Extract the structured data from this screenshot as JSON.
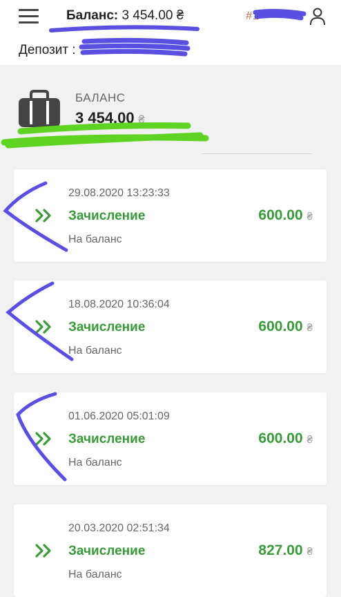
{
  "header": {
    "balance_label": "Баланс:",
    "balance_value": "3 454.00",
    "currency": "₴",
    "account_id": "#1",
    "deposit_label": "Депозит :"
  },
  "summary": {
    "label": "БАЛАНС",
    "amount": "3 454.00",
    "currency": "₴"
  },
  "transactions": [
    {
      "date": "29.08.2020 13:23:33",
      "type": "Зачисление",
      "amount": "600.00",
      "currency": "₴",
      "description": "На баланс"
    },
    {
      "date": "18.08.2020 10:36:04",
      "type": "Зачисление",
      "amount": "600.00",
      "currency": "₴",
      "description": "На баланс"
    },
    {
      "date": "01.06.2020 05:01:09",
      "type": "Зачисление",
      "amount": "600.00",
      "currency": "₴",
      "description": "На баланс"
    },
    {
      "date": "20.03.2020 02:51:34",
      "type": "Зачисление",
      "amount": "827.00",
      "currency": "₴",
      "description": "На баланс"
    }
  ],
  "icons": {
    "menu": "hamburger-menu-icon",
    "user": "user-icon",
    "wallet": "briefcase-wallet-icon",
    "transaction": "double-chevron-right-icon"
  },
  "colors": {
    "accent_green": "#3a9a3a",
    "account_id": "#c8745a",
    "scribble_blue": "#5a4fe0",
    "scribble_green": "#5ed321"
  }
}
